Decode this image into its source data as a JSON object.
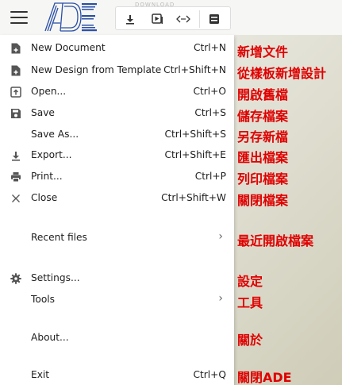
{
  "toolbar": {
    "faint_label": "DOWNLOAD",
    "icons": [
      "hamburger-icon",
      "download-icon",
      "play-icon",
      "code-icon",
      "panel-icon"
    ]
  },
  "logo": {
    "text": "ADE",
    "color": "#2a4fa8"
  },
  "menu": {
    "items": [
      {
        "label": "New Document",
        "shortcut": "Ctrl+N",
        "icon": "new-document-icon",
        "translation": "新增文件"
      },
      {
        "label": "New Design from Template",
        "shortcut": "Ctrl+Shift+N",
        "icon": "new-template-icon",
        "translation": "從樣板新增設計"
      },
      {
        "label": "Open...",
        "shortcut": "Ctrl+O",
        "icon": "open-icon",
        "translation": "開啟舊檔"
      },
      {
        "label": "Save",
        "shortcut": "Ctrl+S",
        "icon": "save-icon",
        "translation": "儲存檔案"
      },
      {
        "label": "Save As...",
        "shortcut": "Ctrl+Shift+S",
        "icon": "",
        "translation": "另存新檔"
      },
      {
        "label": "Export...",
        "shortcut": "Ctrl+Shift+E",
        "icon": "export-icon",
        "translation": "匯出檔案"
      },
      {
        "label": "Print...",
        "shortcut": "Ctrl+P",
        "icon": "print-icon",
        "translation": "列印檔案"
      },
      {
        "label": "Close",
        "shortcut": "Ctrl+Shift+W",
        "icon": "close-icon",
        "translation": "關閉檔案"
      },
      {
        "label": "Recent files",
        "shortcut": "",
        "icon": "",
        "submenu": true,
        "translation": "最近開啟檔案"
      },
      {
        "label": "Settings...",
        "shortcut": "",
        "icon": "gear-icon",
        "translation": "設定"
      },
      {
        "label": "Tools",
        "shortcut": "",
        "icon": "",
        "submenu": true,
        "translation": "工具"
      },
      {
        "label": "About...",
        "shortcut": "",
        "icon": "",
        "translation": "關於"
      },
      {
        "label": "Exit",
        "shortcut": "Ctrl+Q",
        "icon": "",
        "translation": "關閉ADE"
      }
    ]
  },
  "colors": {
    "translation_text": "#e00000",
    "icon": "#555555"
  }
}
